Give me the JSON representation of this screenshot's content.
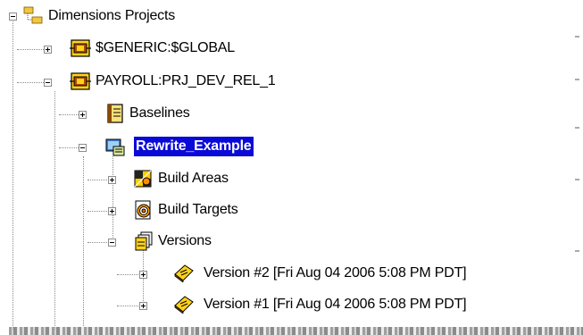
{
  "tree": {
    "root": {
      "label": "Dimensions Projects",
      "icon": "project-tree-icon",
      "expanded": true
    },
    "nodes": [
      {
        "label": "$GENERIC:$GLOBAL",
        "icon": "project-icon",
        "expanded": false
      },
      {
        "label": "PAYROLL:PRJ_DEV_REL_1",
        "icon": "project-icon",
        "expanded": true
      },
      {
        "label": "Baselines",
        "icon": "baselines-icon",
        "expanded": false
      },
      {
        "label": "Rewrite_Example",
        "icon": "request-icon",
        "expanded": true,
        "selected": true
      },
      {
        "label": "Build Areas",
        "icon": "build-areas-icon",
        "expanded": false
      },
      {
        "label": "Build Targets",
        "icon": "build-targets-icon",
        "expanded": false
      },
      {
        "label": "Versions",
        "icon": "versions-icon",
        "expanded": true
      },
      {
        "label": "Version #2 [Fri Aug 04 2006 5:08 PM PDT]",
        "icon": "version-book-icon",
        "expanded": false
      },
      {
        "label": "Version #1 [Fri Aug 04 2006 5:08 PM PDT]",
        "icon": "version-book-icon",
        "expanded": false
      }
    ]
  },
  "colors": {
    "selection": "#0a0ad8",
    "connector": "#8a8a8a",
    "folder": "#e8b800"
  }
}
